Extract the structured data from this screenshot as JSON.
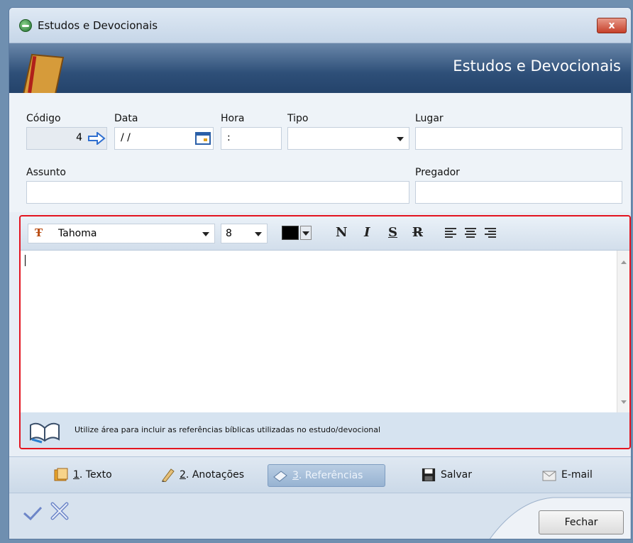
{
  "window": {
    "title": "Estudos e Devocionais",
    "close_symbol": "x",
    "banner_title": "Estudos e Devocionais"
  },
  "form": {
    "codigo_label": "Código",
    "codigo_value": "4",
    "data_label": "Data",
    "data_value": " / /",
    "hora_label": "Hora",
    "hora_value": ":",
    "tipo_label": "Tipo",
    "tipo_value": "",
    "lugar_label": "Lugar",
    "lugar_value": "",
    "assunto_label": "Assunto",
    "assunto_value": "",
    "pregador_label": "Pregador",
    "pregador_value": ""
  },
  "editor": {
    "font_name": "Tahoma",
    "font_size": "8",
    "font_color": "#000000",
    "bold_label": "N",
    "italic_label": "I",
    "underline_label": "S",
    "strike_label": "R",
    "hint": "Utilize área para incluir as referências bíblicas utilizadas no estudo/devocional"
  },
  "tabs": [
    {
      "number": "1",
      "label": ". Texto",
      "icon": "folder-icon"
    },
    {
      "number": "2",
      "label": ". Anotações",
      "icon": "pencil-icon"
    },
    {
      "number": "3",
      "label": ". Referências",
      "icon": "eraser-icon"
    }
  ],
  "actions": {
    "save_label": "Salvar",
    "email_label": "E-mail",
    "close_label": "Fechar"
  },
  "colors": {
    "highlight_border": "#e3141f",
    "banner": "#2e4f78"
  }
}
